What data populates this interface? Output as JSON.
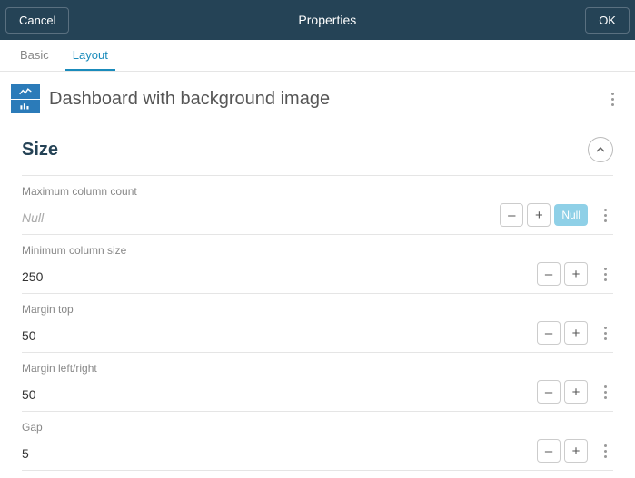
{
  "header": {
    "cancel": "Cancel",
    "title": "Properties",
    "ok": "OK"
  },
  "tabs": {
    "basic": "Basic",
    "layout": "Layout"
  },
  "page": {
    "title": "Dashboard with background image"
  },
  "section": {
    "title": "Size"
  },
  "fields": {
    "maxCol": {
      "label": "Maximum column count",
      "value": "Null",
      "nullPill": "Null"
    },
    "minCol": {
      "label": "Minimum column size",
      "value": "250"
    },
    "marginTop": {
      "label": "Margin top",
      "value": "50"
    },
    "marginLR": {
      "label": "Margin left/right",
      "value": "50"
    },
    "gap": {
      "label": "Gap",
      "value": "5"
    }
  },
  "glyphs": {
    "minus": "–",
    "plus": "+"
  }
}
